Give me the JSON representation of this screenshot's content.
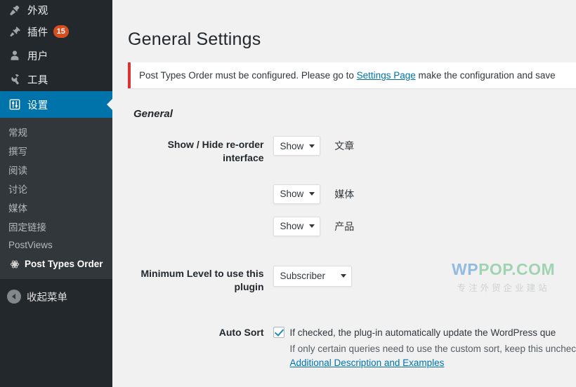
{
  "sidebar": {
    "menu": [
      {
        "label": "外观",
        "icon": "appearance-brush-icon",
        "badge": null
      },
      {
        "label": "插件",
        "icon": "plugins-plug-icon",
        "badge": "15"
      },
      {
        "label": "用户",
        "icon": "users-person-icon",
        "badge": null
      },
      {
        "label": "工具",
        "icon": "tools-wrench-icon",
        "badge": null
      },
      {
        "label": "设置",
        "icon": "settings-sliders-icon",
        "badge": null,
        "active": true
      }
    ],
    "submenu": [
      {
        "label": "常规"
      },
      {
        "label": "撰写"
      },
      {
        "label": "阅读"
      },
      {
        "label": "讨论"
      },
      {
        "label": "媒体"
      },
      {
        "label": "固定链接"
      },
      {
        "label": "PostViews"
      },
      {
        "label": "Post Types Order",
        "icon": "atom-icon",
        "current": true
      }
    ],
    "collapse": {
      "label": "收起菜单",
      "icon": "collapse-arrow-icon"
    }
  },
  "main": {
    "page_title": "General Settings",
    "notice": {
      "text_before": "Post Types Order must be configured. Please go to ",
      "link": "Settings Page",
      "text_after": " make the configuration and save"
    },
    "section_general": "General",
    "rows": {
      "show_hide": {
        "label": "Show / Hide re-order interface",
        "items": [
          {
            "select_value": "Show",
            "type_label": "文章"
          },
          {
            "select_value": "Show",
            "type_label": "媒体"
          },
          {
            "select_value": "Show",
            "type_label": "产品"
          }
        ]
      },
      "min_level": {
        "label": "Minimum Level to use this plugin",
        "select_value": "Subscriber"
      },
      "auto_sort": {
        "label": "Auto Sort",
        "checked": true,
        "desc_line1": "If checked, the plug-in automatically update the WordPress que",
        "desc_line2": "If only certain queries need to use the custom sort, keep this unchec",
        "link": "Additional Description and Examples"
      }
    }
  },
  "watermark": {
    "part1": "WP",
    "part2": "POP.COM",
    "subtitle": "专注外贸企业建站"
  },
  "colors": {
    "sidebar_bg": "#23282d",
    "submenu_bg": "#32373c",
    "active_blue": "#0073aa",
    "badge_orange": "#d54e21",
    "notice_red": "#dc3232",
    "link_blue": "#0073aa",
    "content_bg": "#f1f1f1"
  }
}
